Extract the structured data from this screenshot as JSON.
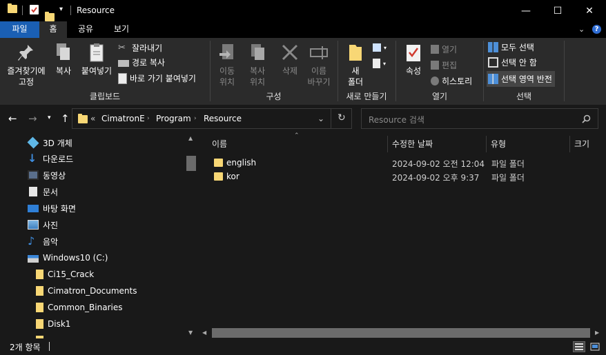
{
  "window": {
    "title": "Resource",
    "minimize": "—",
    "maximize": "☐",
    "close": "✕"
  },
  "ribbon_tabs": {
    "file": "파일",
    "home": "홈",
    "share": "공유",
    "view": "보기",
    "collapse": "⌄",
    "help": "?"
  },
  "clipboard": {
    "pin": "즐겨찾기에\n고정",
    "copy": "복사",
    "paste": "붙여넣기",
    "cut": "잘라내기",
    "copy_path": "경로 복사",
    "paste_shortcut": "바로 가기 붙여넣기",
    "label": "클립보드"
  },
  "organize": {
    "move_to": "이동\n위치",
    "copy_to": "복사\n위치",
    "delete": "삭제",
    "rename": "이름\n바꾸기",
    "label": "구성"
  },
  "new": {
    "new_folder": "새\n폴더",
    "label": "새로 만들기"
  },
  "open": {
    "properties": "속성",
    "open": "열기",
    "edit": "편집",
    "history": "히스토리",
    "label": "열기"
  },
  "select": {
    "select_all": "모두 선택",
    "select_none": "선택 안 함",
    "invert": "선택 영역 반전",
    "label": "선택"
  },
  "address": {
    "overflow": "«",
    "crumbs": [
      "CimatronE",
      "Program",
      "Resource"
    ],
    "refresh": "↻",
    "dropdown": "⌄"
  },
  "search": {
    "placeholder": "Resource 검색"
  },
  "nav_pane": {
    "items": [
      {
        "label": "3D 개체",
        "icon": "3d-objects-icon"
      },
      {
        "label": "다운로드",
        "icon": "download-icon"
      },
      {
        "label": "동영상",
        "icon": "video-icon"
      },
      {
        "label": "문서",
        "icon": "document-icon"
      },
      {
        "label": "바탕 화면",
        "icon": "desktop-icon"
      },
      {
        "label": "사진",
        "icon": "pictures-icon"
      },
      {
        "label": "음악",
        "icon": "music-icon"
      },
      {
        "label": "Windows10 (C:)",
        "icon": "drive-icon"
      },
      {
        "label": "Ci15_Crack",
        "icon": "folder-icon"
      },
      {
        "label": "Cimatron_Documents",
        "icon": "folder-icon"
      },
      {
        "label": "Common_Binaries",
        "icon": "folder-icon"
      },
      {
        "label": "Disk1",
        "icon": "folder-icon"
      }
    ]
  },
  "content": {
    "columns": {
      "name": "이름",
      "date": "수정한 날짜",
      "type": "유형",
      "size": "크기"
    },
    "rows": [
      {
        "name": "english",
        "date": "2024-09-02 오전 12:04",
        "type": "파일 폴더"
      },
      {
        "name": "kor",
        "date": "2024-09-02 오후 9:37",
        "type": "파일 폴더"
      }
    ]
  },
  "status": {
    "count": "2개 항목"
  },
  "colors": {
    "file_tab": "#1a5fb4",
    "folder": "#f8d775",
    "background": "#191919",
    "ribbon": "#2b2b2b"
  }
}
